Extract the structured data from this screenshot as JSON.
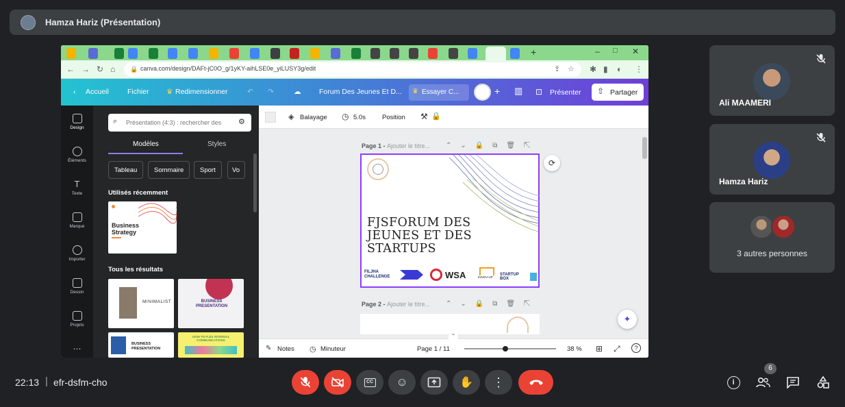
{
  "presenter": {
    "name": "Hamza Hariz (Présentation)"
  },
  "browser": {
    "url": "canva.com/design/DAFt-jC0O_g/1yKY-aihLSE0e_yiLUSY3g/edit",
    "tab_count_hint": "many tabs"
  },
  "canva": {
    "header": {
      "home": "Accueil",
      "file": "Fichier",
      "resize": "Redimensionner",
      "doc_title": "Forum Des Jeunes Et D...",
      "try": "Essayer C...",
      "present": "Présenter",
      "share": "Partager"
    },
    "rail": [
      {
        "label": "Design",
        "icon": "design-icon"
      },
      {
        "label": "Éléments",
        "icon": "elements-icon"
      },
      {
        "label": "Texte",
        "icon": "text-icon"
      },
      {
        "label": "Marque",
        "icon": "brand-icon"
      },
      {
        "label": "Importer",
        "icon": "upload-icon"
      },
      {
        "label": "Dessin",
        "icon": "draw-icon"
      },
      {
        "label": "Projets",
        "icon": "folder-icon"
      }
    ],
    "panel": {
      "search_placeholder": "Présentation (4:3) : rechercher des",
      "tab_templates": "Modèles",
      "tab_styles": "Styles",
      "chips": [
        "Tableau",
        "Sommaire",
        "Sport",
        "Vo"
      ],
      "recent_heading": "Utilisés récemment",
      "recent_thumb_text": "Business Strategy",
      "all_heading": "Tous les résultats",
      "result_texts": [
        "MINIMALIST",
        "BUSINESS PRESENTATION",
        "BUSINESS PRESENTATION",
        "HOW TO FLEX INTERNAL COMMUNICATIONS"
      ]
    },
    "toolbar": {
      "transition": "Balayage",
      "duration": "5.0s",
      "position": "Position"
    },
    "pages": {
      "page1_prefix": "Page 1 - ",
      "page1_title": "Ajouter le titre...",
      "page2_prefix": "Page 2 - ",
      "page2_title": "Ajouter le titre..."
    },
    "slide": {
      "title": "FJSFORUM DES JEUNES ET DES STARTUPS",
      "logos": [
        "FILJHA CHALLENGE",
        "WSA",
        "INNOV-UP",
        "STARTUP BOX"
      ]
    },
    "bottom": {
      "notes": "Notes",
      "timer": "Minuteur",
      "page_indicator": "Page 1 / 11",
      "zoom": "38 %",
      "zoom_level": 0.38
    }
  },
  "participants": [
    {
      "name": "Ali MAAMERI",
      "muted": true
    },
    {
      "name": "Hamza Hariz",
      "muted": true
    }
  ],
  "others": {
    "label": "3 autres personnes"
  },
  "meeting": {
    "time": "22:13",
    "code": "efr-dsfm-cho",
    "people_count": "6"
  },
  "colors": {
    "meet_bg": "#202124",
    "tile_bg": "#3c4043",
    "danger": "#ea4335",
    "canva_purple": "#8b3dff",
    "tab_strip": "#8bd88c"
  }
}
